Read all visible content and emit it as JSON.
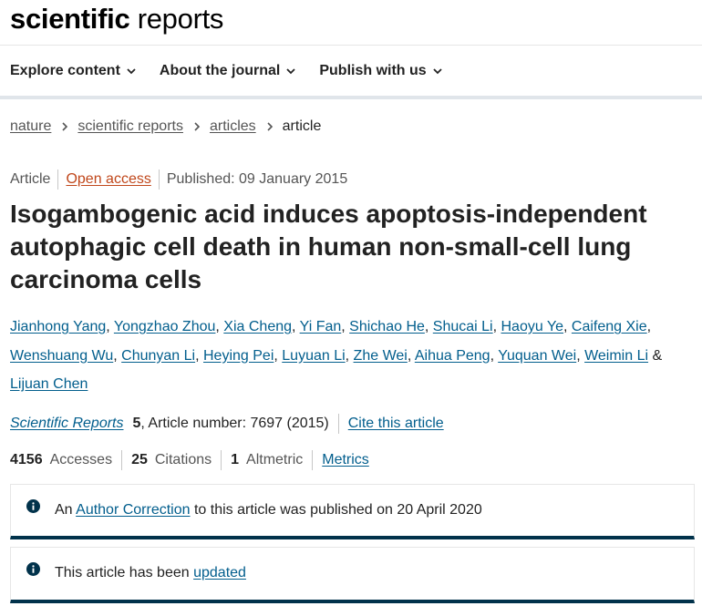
{
  "header": {
    "logo_bold": "scientific",
    "logo_regular": "reports"
  },
  "nav": {
    "items": [
      {
        "label": "Explore content"
      },
      {
        "label": "About the journal"
      },
      {
        "label": "Publish with us"
      }
    ]
  },
  "breadcrumb": {
    "items": [
      "nature",
      "scientific reports",
      "articles"
    ],
    "current": "article"
  },
  "article": {
    "type": "Article",
    "access": "Open access",
    "published": "Published: 09 January 2015",
    "title": "Isogambogenic acid induces apoptosis-independent autophagic cell death in human non-small-cell lung carcinoma cells",
    "authors": [
      "Jianhong Yang",
      "Yongzhao Zhou",
      "Xia Cheng",
      "Yi Fan",
      "Shichao He",
      "Shucai Li",
      "Haoyu Ye",
      "Caifeng Xie",
      "Wenshuang Wu",
      "Chunyan Li",
      "Heying Pei",
      "Luyuan Li",
      "Zhe Wei",
      "Aihua Peng",
      "Yuquan Wei",
      "Weimin Li",
      "Lijuan Chen"
    ],
    "authors_last_joiner": "&",
    "journal": "Scientific Reports",
    "volume": "5",
    "article_number": ", Article number: 7697 (2015)",
    "cite_label": "Cite this article"
  },
  "metrics": {
    "accesses_value": "4156",
    "accesses_label": "Accesses",
    "citations_value": "25",
    "citations_label": "Citations",
    "altmetric_value": "1",
    "altmetric_label": "Altmetric",
    "metrics_link": "Metrics"
  },
  "notices": {
    "correction": {
      "prefix": "An",
      "link": "Author Correction",
      "suffix": "to this article was published on 20 April 2020"
    },
    "update": {
      "prefix": "This article has been",
      "link": "updated"
    }
  },
  "colors": {
    "link": "#025e8d",
    "open_access": "#c0471b",
    "notice_bar": "#01324b"
  }
}
